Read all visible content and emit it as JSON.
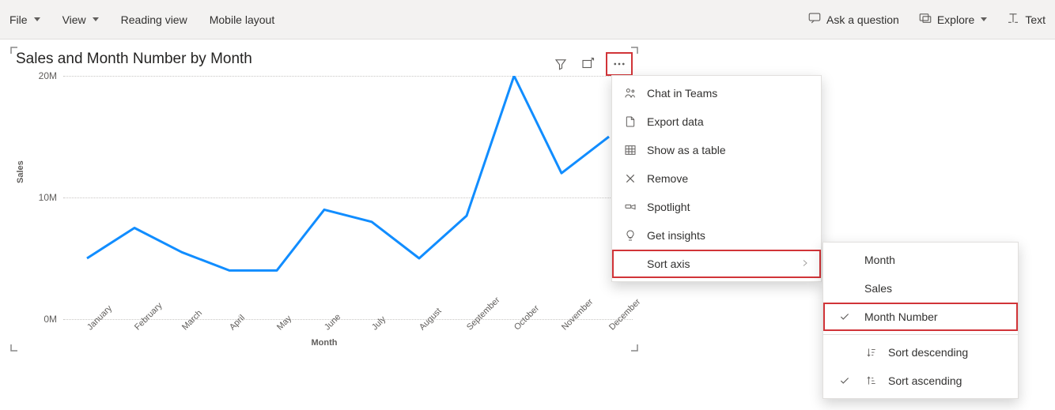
{
  "toolbar": {
    "file": "File",
    "view": "View",
    "reading_view": "Reading view",
    "mobile_layout": "Mobile layout",
    "ask_question": "Ask a question",
    "explore": "Explore",
    "text": "Text"
  },
  "chart": {
    "title": "Sales and Month Number by Month",
    "xlabel": "Month",
    "ylabel": "Sales"
  },
  "menu": {
    "chat_in_teams": "Chat in Teams",
    "export_data": "Export data",
    "show_as_table": "Show as a table",
    "remove": "Remove",
    "spotlight": "Spotlight",
    "get_insights": "Get insights",
    "sort_axis": "Sort axis"
  },
  "submenu": {
    "month": "Month",
    "sales": "Sales",
    "month_number": "Month Number",
    "sort_descending": "Sort descending",
    "sort_ascending": "Sort ascending"
  },
  "chart_data": {
    "type": "line",
    "title": "Sales and Month Number by Month",
    "xlabel": "Month",
    "ylabel": "Sales",
    "ylim": [
      0,
      20
    ],
    "yticks": [
      0,
      10,
      20
    ],
    "ytick_labels": [
      "0M",
      "10M",
      "20M"
    ],
    "categories": [
      "January",
      "February",
      "March",
      "April",
      "May",
      "June",
      "July",
      "August",
      "September",
      "October",
      "November",
      "December"
    ],
    "series": [
      {
        "name": "Sales",
        "values": [
          5.0,
          7.5,
          5.5,
          4.0,
          4.0,
          9.0,
          8.0,
          5.0,
          8.5,
          20.0,
          12.0,
          15.0
        ]
      }
    ]
  }
}
